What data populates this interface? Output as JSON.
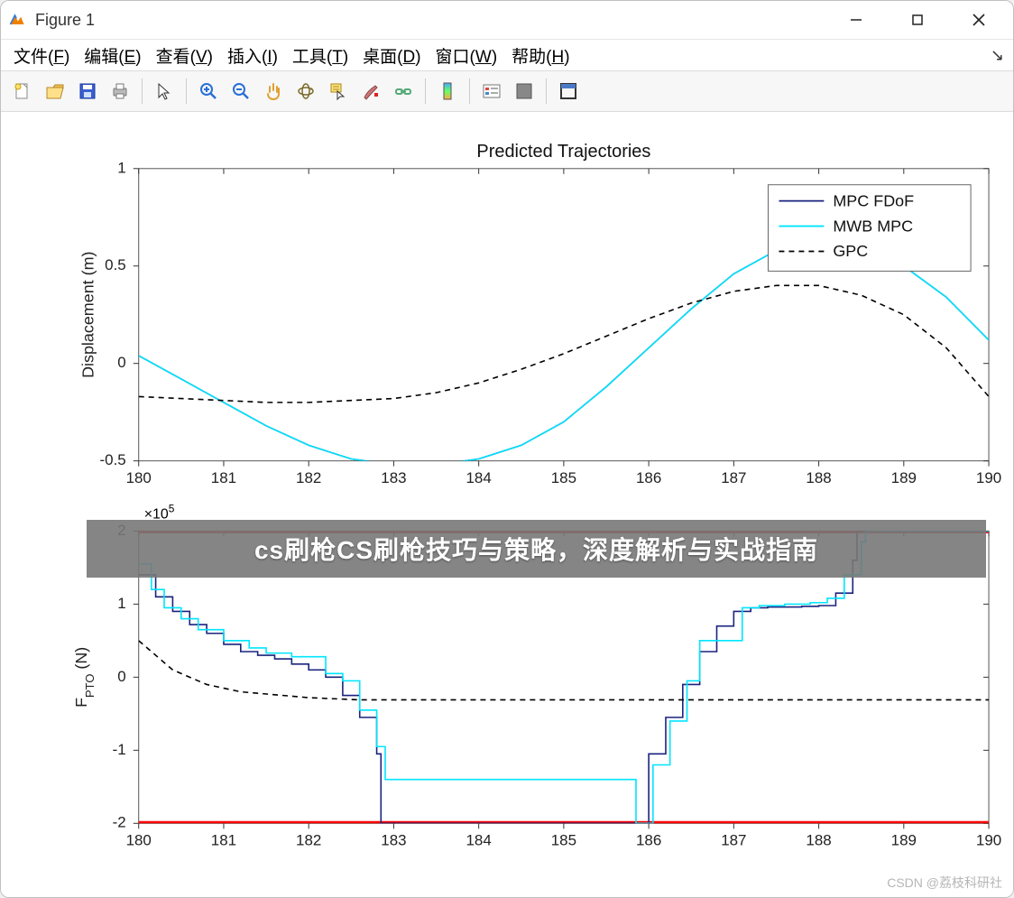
{
  "window": {
    "title": "Figure 1"
  },
  "menubar": {
    "items": [
      {
        "label": "文件",
        "accel": "F"
      },
      {
        "label": "编辑",
        "accel": "E"
      },
      {
        "label": "查看",
        "accel": "V"
      },
      {
        "label": "插入",
        "accel": "I"
      },
      {
        "label": "工具",
        "accel": "T"
      },
      {
        "label": "桌面",
        "accel": "D"
      },
      {
        "label": "窗口",
        "accel": "W"
      },
      {
        "label": "帮助",
        "accel": "H"
      }
    ]
  },
  "toolbar": {
    "names": [
      "new-figure",
      "open",
      "save",
      "print",
      "pointer",
      "zoom-in",
      "zoom-out",
      "pan",
      "rotate-3d",
      "data-cursor",
      "brush",
      "link",
      "colorbar",
      "legend",
      "insert-axes",
      "dock-figure"
    ]
  },
  "overlay": {
    "text": "cs刷枪CS刷枪技巧与策略，深度解析与实战指南"
  },
  "watermark": {
    "text": "CSDN @荔枝科研社"
  },
  "chart_data": [
    {
      "type": "line",
      "title": "Predicted Trajectories",
      "xlabel": "",
      "ylabel": "Displacement (m)",
      "xlim": [
        180,
        190
      ],
      "ylim": [
        -0.5,
        1.0
      ],
      "xticks": [
        180,
        181,
        182,
        183,
        184,
        185,
        186,
        187,
        188,
        189,
        190
      ],
      "yticks": [
        -0.5,
        0,
        0.5,
        1.0
      ],
      "legend": [
        "MPC FDoF",
        "MWB MPC",
        "GPC"
      ],
      "x": [
        180,
        180.5,
        181,
        181.5,
        182,
        182.5,
        183,
        183.5,
        184,
        184.5,
        185,
        185.5,
        186,
        186.5,
        187,
        187.5,
        188,
        188.5,
        189,
        189.5,
        190
      ],
      "series": [
        {
          "name": "MPC FDoF",
          "color": "#1a237e",
          "dash": "none",
          "values": [
            0.04,
            -0.08,
            -0.2,
            -0.32,
            -0.42,
            -0.49,
            -0.52,
            -0.52,
            -0.49,
            -0.42,
            -0.3,
            -0.12,
            0.08,
            0.28,
            0.46,
            0.58,
            0.63,
            0.6,
            0.5,
            0.34,
            0.12
          ]
        },
        {
          "name": "MWB MPC",
          "color": "#00e5ff",
          "dash": "none",
          "values": [
            0.04,
            -0.08,
            -0.2,
            -0.32,
            -0.42,
            -0.49,
            -0.52,
            -0.52,
            -0.49,
            -0.42,
            -0.3,
            -0.12,
            0.08,
            0.28,
            0.46,
            0.58,
            0.63,
            0.6,
            0.5,
            0.34,
            0.12
          ]
        },
        {
          "name": "GPC",
          "color": "#000000",
          "dash": "6,5",
          "values": [
            -0.17,
            -0.18,
            -0.19,
            -0.2,
            -0.2,
            -0.19,
            -0.18,
            -0.15,
            -0.1,
            -0.03,
            0.05,
            0.14,
            0.23,
            0.31,
            0.37,
            0.4,
            0.4,
            0.35,
            0.25,
            0.08,
            -0.17
          ]
        }
      ]
    },
    {
      "type": "line",
      "title": "",
      "xlabel": "",
      "ylabel": "F_PTO (N)",
      "y_exponent_label": "×10^5",
      "xlim": [
        180,
        190
      ],
      "ylim": [
        -2,
        2
      ],
      "xticks": [
        180,
        181,
        182,
        183,
        184,
        185,
        186,
        187,
        188,
        189,
        190
      ],
      "yticks": [
        -2,
        -1,
        0,
        1,
        2
      ],
      "constraint_lines": {
        "color": "#ff0000",
        "values": [
          -2,
          2
        ]
      },
      "series": [
        {
          "name": "MPC FDoF",
          "color": "#1a237e",
          "style": "step",
          "dash": "none",
          "x": [
            180,
            180.2,
            180.4,
            180.6,
            180.8,
            181,
            181.2,
            181.4,
            181.6,
            181.8,
            182,
            182.2,
            182.4,
            182.6,
            182.8,
            182.85,
            185.95,
            186.0,
            186.2,
            186.4,
            186.6,
            186.8,
            187,
            187.2,
            187.4,
            187.6,
            187.8,
            188,
            188.2,
            188.4,
            188.45,
            190
          ],
          "values": [
            1.4,
            1.1,
            0.9,
            0.72,
            0.6,
            0.45,
            0.35,
            0.3,
            0.25,
            0.18,
            0.1,
            0.0,
            -0.25,
            -0.55,
            -1.05,
            -2.0,
            -2.0,
            -1.05,
            -0.55,
            -0.1,
            0.35,
            0.7,
            0.9,
            0.95,
            0.96,
            0.96,
            0.97,
            0.98,
            1.15,
            1.6,
            2.0,
            2.0
          ]
        },
        {
          "name": "MWB MPC",
          "color": "#00e5ff",
          "style": "step",
          "dash": "none",
          "x": [
            180,
            180.15,
            180.3,
            180.5,
            180.7,
            181,
            181.3,
            181.5,
            181.8,
            182,
            182.2,
            182.4,
            182.6,
            182.8,
            182.9,
            185.85,
            185.9,
            186.05,
            186.25,
            186.45,
            186.6,
            186.9,
            187.1,
            187.3,
            187.6,
            187.9,
            188.1,
            188.3,
            188.5,
            188.55,
            190
          ],
          "values": [
            1.55,
            1.2,
            0.95,
            0.8,
            0.65,
            0.5,
            0.4,
            0.33,
            0.28,
            0.28,
            0.05,
            -0.05,
            -0.45,
            -0.95,
            -1.4,
            -2.0,
            -2.0,
            -1.2,
            -0.6,
            -0.05,
            0.5,
            0.5,
            0.95,
            0.98,
            1.0,
            1.02,
            1.08,
            1.4,
            1.85,
            2.0,
            2.0
          ]
        },
        {
          "name": "GPC",
          "color": "#000000",
          "style": "line",
          "dash": "6,5",
          "x": [
            180,
            180.4,
            180.8,
            181.2,
            181.6,
            182,
            182.4,
            182.6,
            190
          ],
          "values": [
            0.5,
            0.1,
            -0.1,
            -0.2,
            -0.24,
            -0.28,
            -0.3,
            -0.31,
            -0.31
          ]
        }
      ]
    }
  ]
}
